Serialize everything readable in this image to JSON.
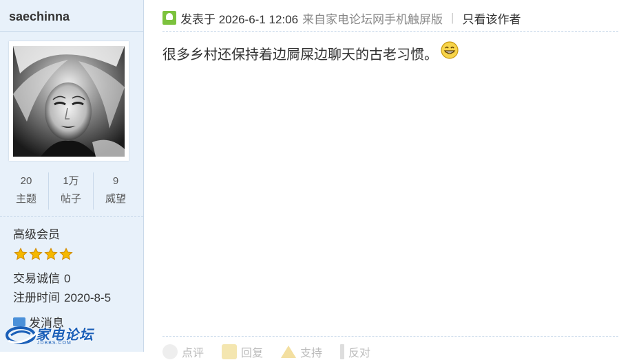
{
  "sidebar": {
    "username": "saechinna",
    "stats": [
      {
        "value": "20",
        "label": "主题"
      },
      {
        "value": "1万",
        "label": "帖子"
      },
      {
        "value": "9",
        "label": "威望"
      }
    ],
    "group": "高级会员",
    "star_count": 4,
    "credit_label": "交易诚信",
    "credit_value": "0",
    "reg_label": "注册时间",
    "reg_value": "2020-8-5",
    "message_label": "发消息"
  },
  "post": {
    "posted_at": "发表于 2026-6-1 12:06",
    "source": "来自家电论坛网手机触屏版",
    "separator": "|",
    "author_only": "只看该作者",
    "content": "很多乡村还保持着边屙屎边聊天的古老习惯。",
    "emoji_icon": "grin-emoji-icon"
  },
  "actions": [
    {
      "label": "点评"
    },
    {
      "label": "回复"
    },
    {
      "label": "支持"
    },
    {
      "label": "反对"
    }
  ],
  "watermark": {
    "brand": "家电论坛",
    "domain": "JDBBS.COM"
  },
  "colors": {
    "sidebar_bg": "#e8f1fa",
    "accent_blue": "#1a5fb8",
    "post_icon_green": "#7cc23d",
    "star_gold": "#f5b800"
  }
}
